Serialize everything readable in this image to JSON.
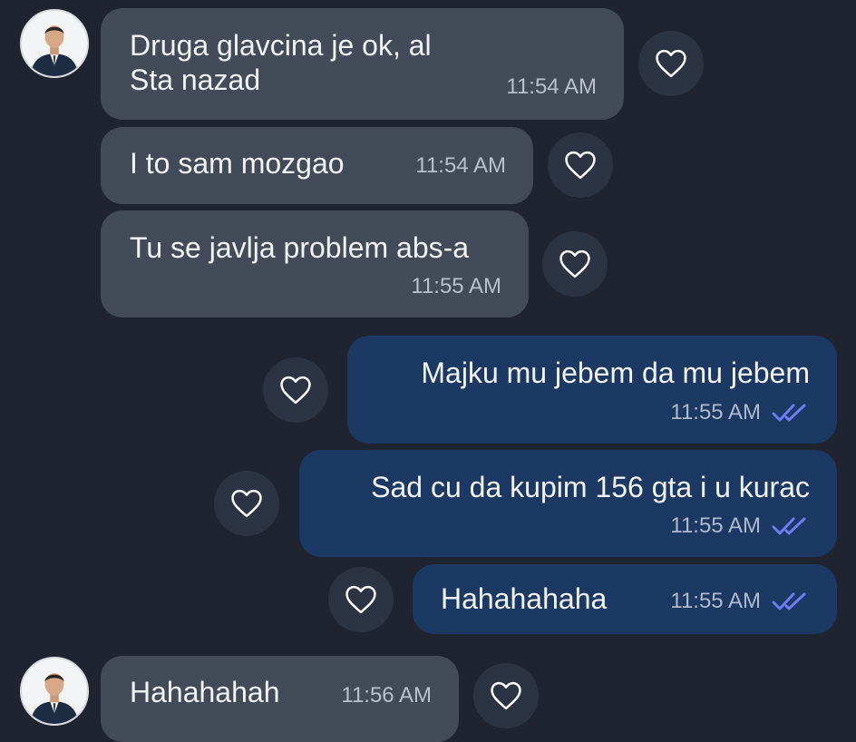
{
  "colors": {
    "background": "#1f2430",
    "incoming_bubble": "#434b59",
    "outgoing_bubble": "#1c3963",
    "read_ticks": "#6f7cf2",
    "reaction_button": "#2c3444"
  },
  "icons": {
    "reaction": "heart-outline-icon",
    "status": "double-check-icon",
    "avatar": "contact-avatar"
  },
  "messages": [
    {
      "direction": "incoming",
      "text_line1": "Druga glavcina je ok, al",
      "text_line2": "Sta nazad",
      "time": "11:54 AM"
    },
    {
      "direction": "incoming",
      "text": "I to sam mozgao",
      "time": "11:54 AM"
    },
    {
      "direction": "incoming",
      "text": "Tu se javlja problem abs-a",
      "time": "11:55 AM"
    },
    {
      "direction": "outgoing",
      "text": "Majku mu jebem da mu jebem",
      "time": "11:55 AM",
      "status": "read"
    },
    {
      "direction": "outgoing",
      "text": "Sad cu da kupim 156 gta i u kurac",
      "time": "11:55 AM",
      "status": "read"
    },
    {
      "direction": "outgoing",
      "text": "Hahahahaha",
      "time": "11:55 AM",
      "status": "read"
    },
    {
      "direction": "incoming",
      "text": "Hahahahah",
      "time": "11:56 AM"
    }
  ]
}
